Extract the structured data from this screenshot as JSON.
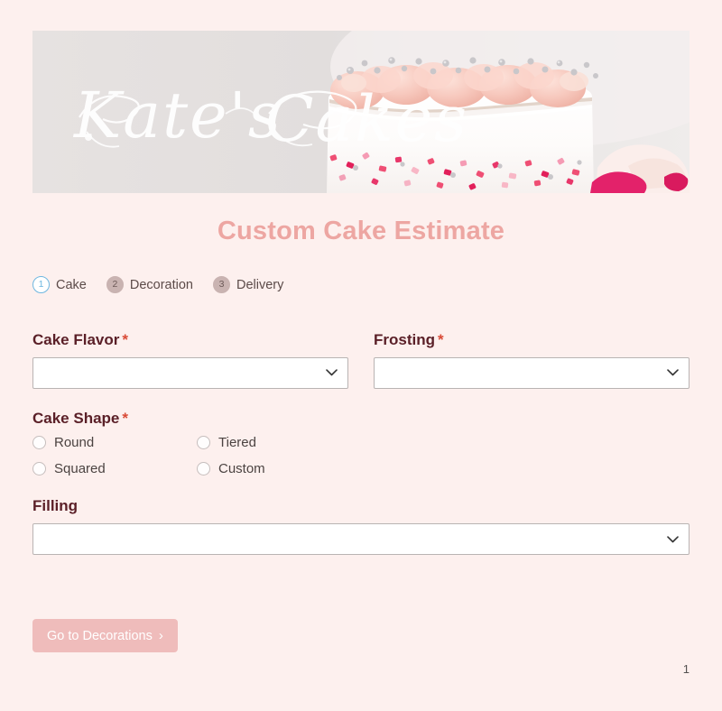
{
  "banner": {
    "brand_text": "Kate's Cakes",
    "alt": "cake-photo-banner",
    "bg_color": "#e3dfde",
    "cake_frosting_color": "#f6c6bf",
    "sprinkle_color": "#e8376a"
  },
  "header": {
    "title": "Custom Cake Estimate",
    "title_color": "#eda6a2"
  },
  "steps": [
    {
      "number": "1",
      "label": "Cake",
      "state": "active"
    },
    {
      "number": "2",
      "label": "Decoration",
      "state": "inactive"
    },
    {
      "number": "3",
      "label": "Delivery",
      "state": "inactive"
    }
  ],
  "form": {
    "cake_flavor": {
      "label": "Cake Flavor",
      "required_mark": "*",
      "value": "",
      "placeholder": ""
    },
    "frosting": {
      "label": "Frosting",
      "required_mark": "*",
      "value": "",
      "placeholder": ""
    },
    "cake_shape": {
      "label": "Cake Shape",
      "required_mark": "*",
      "selected": "",
      "options": [
        {
          "label": "Round",
          "checked": false
        },
        {
          "label": "Tiered",
          "checked": false
        },
        {
          "label": "Squared",
          "checked": false
        },
        {
          "label": "Custom",
          "checked": false
        }
      ]
    },
    "filling": {
      "label": "Filling",
      "required_mark": "",
      "value": "",
      "placeholder": ""
    }
  },
  "actions": {
    "next_label": "Go to Decorations",
    "next_arrow": "›",
    "next_bg": "#efbcbb"
  },
  "footer": {
    "page_number": "1"
  },
  "icons": {
    "chevron_down": "chevron-down-icon",
    "chevron_right": "chevron-right-icon"
  }
}
